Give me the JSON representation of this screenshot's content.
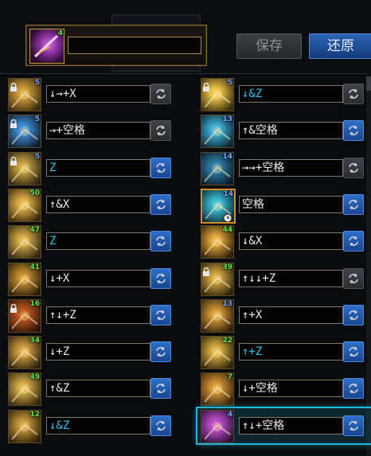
{
  "toolbar": {
    "save_label": "保存",
    "restore_label": "还原"
  },
  "selected_skill": {
    "level": "4",
    "command": ""
  },
  "left_column": [
    {
      "level": "5",
      "lvl_color": "b",
      "locked": true,
      "command": "↓→+X",
      "command_color": "w",
      "swap_active": false,
      "icon": "bright-slash-skill-icon",
      "c1": "#d3a23a",
      "c2": "#3b2a10"
    },
    {
      "level": "5",
      "lvl_color": "b",
      "locked": true,
      "command": "→+空格",
      "command_color": "w",
      "swap_active": false,
      "icon": "blue-device-skill-icon",
      "c1": "#3f8fd6",
      "c2": "#0f1b2e"
    },
    {
      "level": "5",
      "lvl_color": "b",
      "locked": true,
      "command": "Z",
      "command_color": "c",
      "swap_active": true,
      "icon": "grenade-skill-icon",
      "c1": "#caa544",
      "c2": "#2c2410"
    },
    {
      "level": "50",
      "lvl_color": "g",
      "locked": false,
      "command": "↑&X",
      "command_color": "w",
      "swap_active": true,
      "icon": "burst-shot-skill-icon",
      "c1": "#e2b24a",
      "c2": "#3a260a"
    },
    {
      "level": "47",
      "lvl_color": "g",
      "locked": false,
      "command": "Z",
      "command_color": "c",
      "swap_active": true,
      "icon": "gold-grenade-skill-icon",
      "c1": "#d6ad48",
      "c2": "#30240c"
    },
    {
      "level": "41",
      "lvl_color": "g",
      "locked": false,
      "command": "↓+X",
      "command_color": "w",
      "swap_active": true,
      "icon": "spin-blade-skill-icon",
      "c1": "#c79232",
      "c2": "#2a1b08"
    },
    {
      "level": "16",
      "lvl_color": "g",
      "locked": true,
      "command": "↑↓+Z",
      "command_color": "w",
      "swap_active": true,
      "icon": "red-mine-skill-icon",
      "c1": "#c15a22",
      "c2": "#2a1006"
    },
    {
      "level": "34",
      "lvl_color": "g",
      "locked": false,
      "command": "↓+Z",
      "command_color": "w",
      "swap_active": true,
      "icon": "vortex-skill-icon",
      "c1": "#d3a144",
      "c2": "#2d1f0a"
    },
    {
      "level": "49",
      "lvl_color": "g",
      "locked": false,
      "command": "↑&Z",
      "command_color": "w",
      "swap_active": true,
      "icon": "gold-bomb-skill-icon",
      "c1": "#d8b04c",
      "c2": "#33270d"
    },
    {
      "level": "12",
      "lvl_color": "g",
      "locked": false,
      "command": "↓&Z",
      "command_color": "c",
      "swap_active": true,
      "icon": "explosion-skill-icon",
      "c1": "#c89a3a",
      "c2": "#2b1d08"
    }
  ],
  "right_column": [
    {
      "level": "5",
      "lvl_color": "b",
      "locked": true,
      "command": "↓&Z",
      "command_color": "c",
      "swap_active": false,
      "icon": "flash-bomb-skill-icon",
      "c1": "#f0c84a",
      "c2": "#3a2c0a",
      "selected": false
    },
    {
      "level": "13",
      "lvl_color": "b",
      "locked": false,
      "command": "↑&空格",
      "command_color": "w",
      "swap_active": true,
      "icon": "wing-turret-skill-icon",
      "c1": "#3fb2d8",
      "c2": "#0c2530",
      "selected": false
    },
    {
      "level": "14",
      "lvl_color": "b",
      "locked": false,
      "command": "→→+空格",
      "command_color": "w",
      "swap_active": false,
      "icon": "mech-drone-skill-icon",
      "c1": "#2f7fa8",
      "c2": "#0a1a26",
      "selected": false
    },
    {
      "level": "14",
      "lvl_color": "b",
      "locked": false,
      "command": "空格",
      "command_color": "w",
      "swap_active": true,
      "icon": "cyan-robot-skill-icon",
      "c1": "#3cc0d8",
      "c2": "#0a2a32",
      "selected": true,
      "clock": true
    },
    {
      "level": "44",
      "lvl_color": "g",
      "locked": false,
      "command": "↓&X",
      "command_color": "w",
      "swap_active": true,
      "icon": "cannon-blast-skill-icon",
      "c1": "#e0a83c",
      "c2": "#2e1e08",
      "selected": false
    },
    {
      "level": "39",
      "lvl_color": "g",
      "locked": true,
      "command": "↑↓↓+Z",
      "command_color": "w",
      "swap_active": false,
      "icon": "gold-mine-skill-icon",
      "c1": "#d0a640",
      "c2": "#2c220b",
      "selected": false
    },
    {
      "level": "13",
      "lvl_color": "b",
      "locked": false,
      "command": "↑+X",
      "command_color": "w",
      "swap_active": true,
      "icon": "gatling-skill-icon",
      "c1": "#d49a3a",
      "c2": "#2e1d08",
      "selected": false
    },
    {
      "level": "22",
      "lvl_color": "g",
      "locked": false,
      "command": "↑+Z",
      "command_color": "c",
      "swap_active": true,
      "icon": "ground-spike-skill-icon",
      "c1": "#d8b042",
      "c2": "#2f230a",
      "selected": false
    },
    {
      "level": "7",
      "lvl_color": "g",
      "locked": false,
      "command": "↓+空格",
      "command_color": "w",
      "swap_active": true,
      "icon": "air-strike-skill-icon",
      "c1": "#d69a3a",
      "c2": "#3a2008",
      "selected": false
    },
    {
      "level": "4",
      "lvl_color": "b",
      "locked": false,
      "command": "↑↓+空格",
      "command_color": "w",
      "swap_active": true,
      "icon": "laser-sword-skill-icon",
      "c1": "#c24fd0",
      "c2": "#2a1030",
      "selected": false,
      "highlighted": true
    }
  ]
}
